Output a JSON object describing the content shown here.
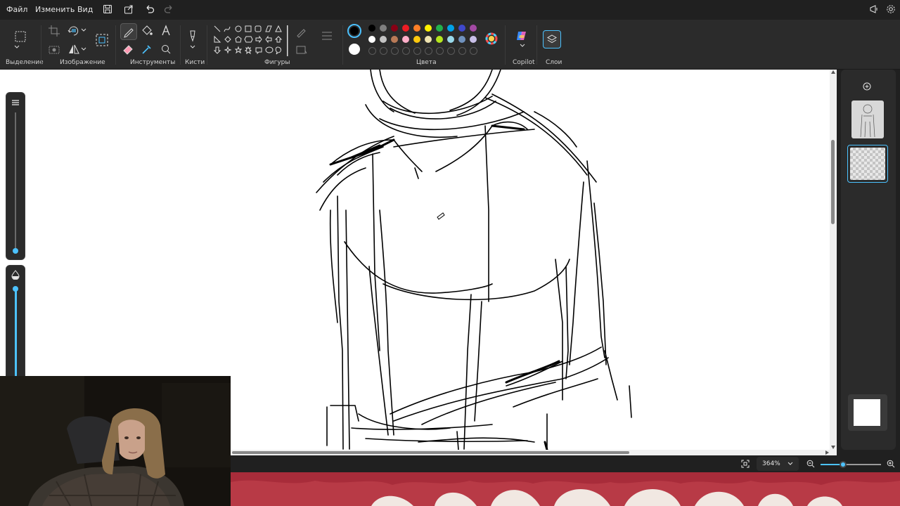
{
  "menu": {
    "file": "Файл",
    "edit": "Изменить",
    "view": "Вид"
  },
  "ribbon": {
    "groups": {
      "selection": "Выделение",
      "image": "Изображение",
      "tools": "Инструменты",
      "brushes": "Кисти",
      "shapes": "Фигуры",
      "colors": "Цвета",
      "copilot": "Copilot",
      "layers": "Слои"
    }
  },
  "colors": {
    "primary": "#000000",
    "secondary": "#ffffff",
    "palette": [
      "#000000",
      "#7f7f7f",
      "#880015",
      "#ed1c24",
      "#ff7f27",
      "#fff200",
      "#22b14c",
      "#00a2e8",
      "#3f48cc",
      "#a349a4",
      "#ffffff",
      "#c3c3c3",
      "#b97a57",
      "#ffaec9",
      "#ffc90e",
      "#efe4b0",
      "#b5e61d",
      "#99d9ea",
      "#7092be",
      "#c8bfe7"
    ],
    "accent": "#4cc2ff"
  },
  "status": {
    "zoom": "364%"
  }
}
